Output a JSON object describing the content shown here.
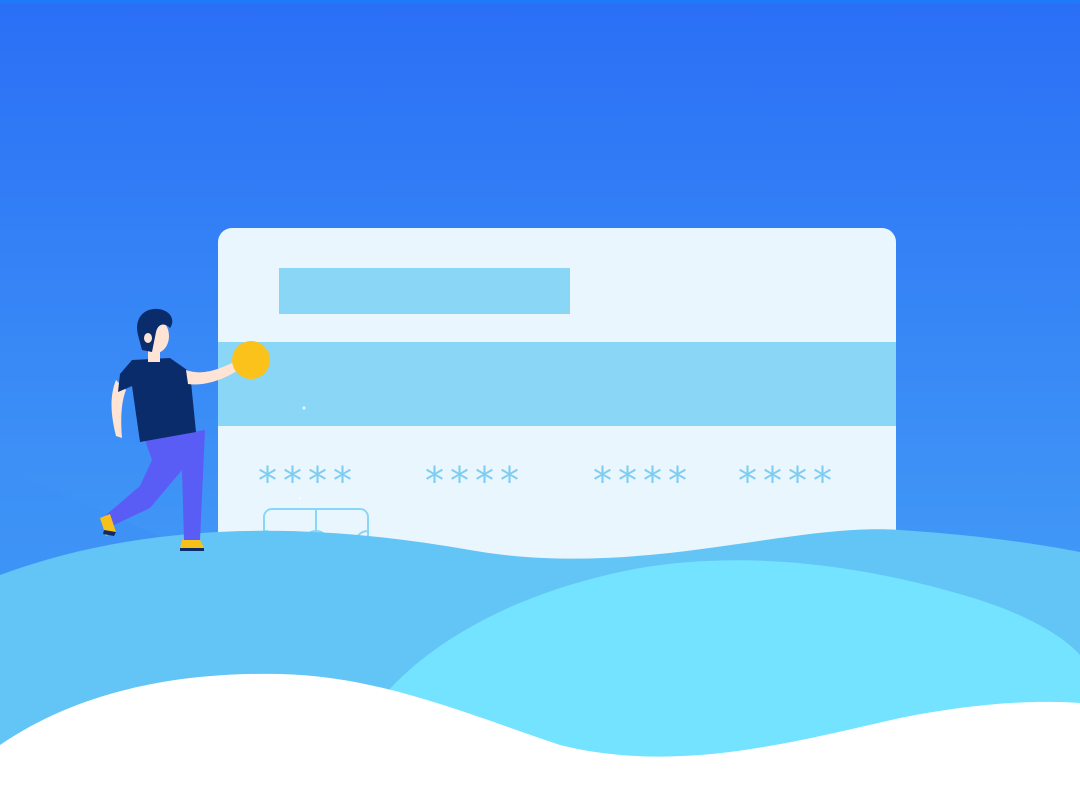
{
  "palette": {
    "sky_top": "#2a6ff6",
    "sky_bottom": "#4aa8f6",
    "hill_left": "#63c4f6",
    "hill_right": "#74e3ff",
    "foreground": "#ffffff",
    "card_fill": "#eaf6fd",
    "card_accent": "#89d6f6",
    "coin": "#fbc21b",
    "shirt": "#0b2c6b",
    "pants": "#5a5cf6",
    "skin": "#ffe4d6",
    "hair": "#0b2c6b",
    "shoe": "#f7c11a"
  },
  "card": {
    "number_groups": [
      "****",
      "****",
      "****",
      "****"
    ],
    "chip_icon": "chip-icon",
    "magnetic_stripe": true,
    "name_bar": true
  },
  "figure": {
    "holding": "coin-icon"
  }
}
